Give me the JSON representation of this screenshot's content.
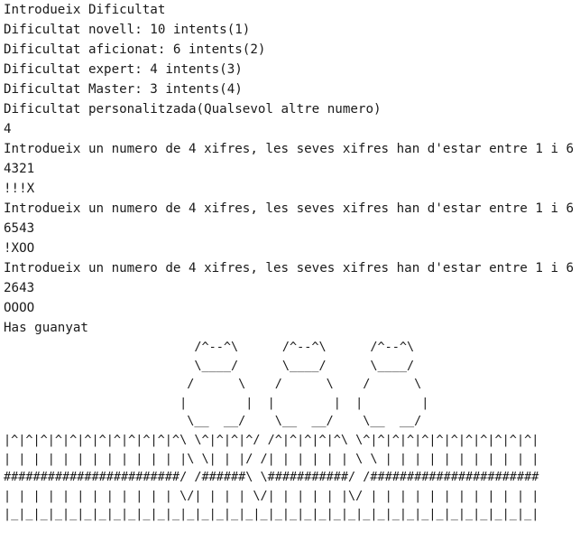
{
  "console": {
    "lines": [
      "Introdueix Dificultat",
      "Dificultat novell: 10 intents(1)",
      "Dificultat aficionat: 6 intents(2)",
      "Dificultat expert: 4 intents(3)",
      "Dificultat Master: 3 intents(4)",
      "Dificultat personalitzada(Qualsevol altre numero)",
      "4",
      "Introdueix un numero de 4 xifres, les seves xifres han d'estar entre 1 i 6",
      "4321",
      "!!!X",
      "Introdueix un numero de 4 xifres, les seves xifres han d'estar entre 1 i 6",
      "6543",
      "!XOO",
      "Introdueix un numero de 4 xifres, les seves xifres han d'estar entre 1 i 6",
      "2643",
      "OOOO",
      "Has guanyat"
    ],
    "art": [
      "                          /^--^\\      /^--^\\      /^--^\\",
      "                          \\____/      \\____/      \\____/",
      "                         /      \\    /      \\    /      \\",
      "                        |        |  |        |  |        |",
      "                         \\__  __/    \\__  __/    \\__  __/",
      "|^|^|^|^|^|^|^|^|^|^|^|^\\ \\^|^|^|^/ /^|^|^|^|^\\ \\^|^|^|^|^|^|^|^|^|^|^|^|",
      "| | | | | | | | | | | | |\\ \\| | |/ /| | | | | | \\ \\ | | | | | | | | | | |",
      "########################/ /######\\ \\###########/ /#######################",
      "| | | | | | | | | | | | \\/| | | | \\/| | | | | |\\/ | | | | | | | | | | | |",
      "|_|_|_|_|_|_|_|_|_|_|_|_|_|_|_|_|_|_|_|_|_|_|_|_|_|_|_|_|_|_|_|_|_|_|_|_|"
    ]
  }
}
